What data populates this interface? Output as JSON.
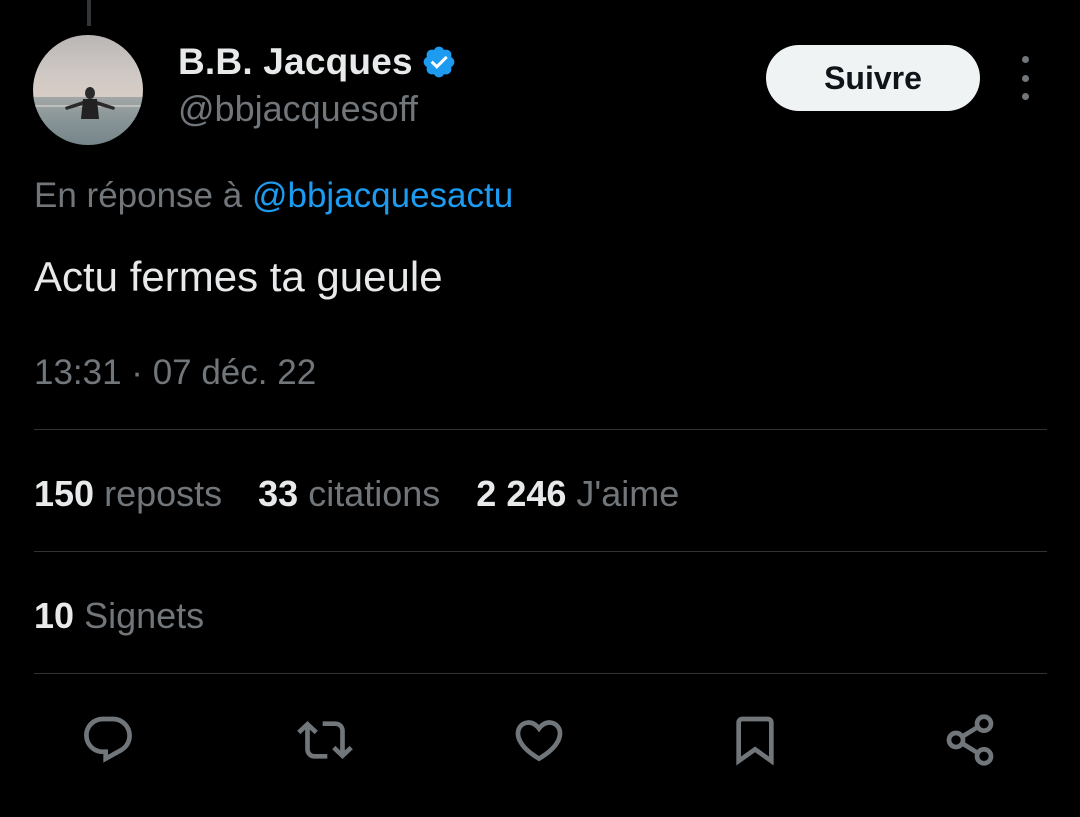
{
  "author": {
    "display_name": "B.B. Jacques",
    "handle": "@bbjacquesoff",
    "verified_icon": "verified-badge-icon"
  },
  "header": {
    "follow_label": "Suivre",
    "more_icon": "more-vertical-icon"
  },
  "tweet": {
    "reply_prefix": "En réponse à",
    "reply_mention": "@bbjacquesactu",
    "text": "Actu fermes ta gueule",
    "timestamp": "13:31 · 07 déc. 22"
  },
  "stats": {
    "reposts_count": "150",
    "reposts_label": "reposts",
    "quotes_count": "33",
    "quotes_label": "citations",
    "likes_count": "2 246",
    "likes_label": "J'aime",
    "bookmarks_count": "10",
    "bookmarks_label": "Signets"
  },
  "actions": [
    "reply-icon",
    "retweet-icon",
    "like-icon",
    "bookmark-icon",
    "share-icon"
  ],
  "colors": {
    "background": "#000000",
    "text_primary": "#e7e9ea",
    "text_secondary": "#71767b",
    "accent": "#1d9bf0",
    "divider": "#2f3336",
    "follow_button_bg": "#eff3f4"
  }
}
